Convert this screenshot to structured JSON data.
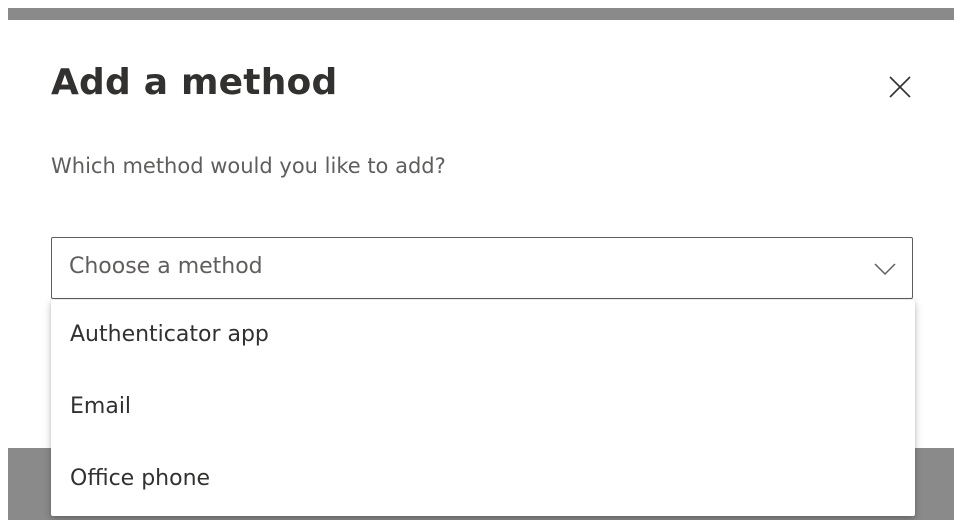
{
  "dialog": {
    "title": "Add a method",
    "subtitle": "Which method would you like to add?",
    "close_icon": "close-icon"
  },
  "select": {
    "placeholder": "Choose a method",
    "chevron_icon": "chevron-down-icon",
    "options": [
      {
        "label": "Authenticator app"
      },
      {
        "label": "Email"
      },
      {
        "label": "Office phone"
      }
    ]
  }
}
